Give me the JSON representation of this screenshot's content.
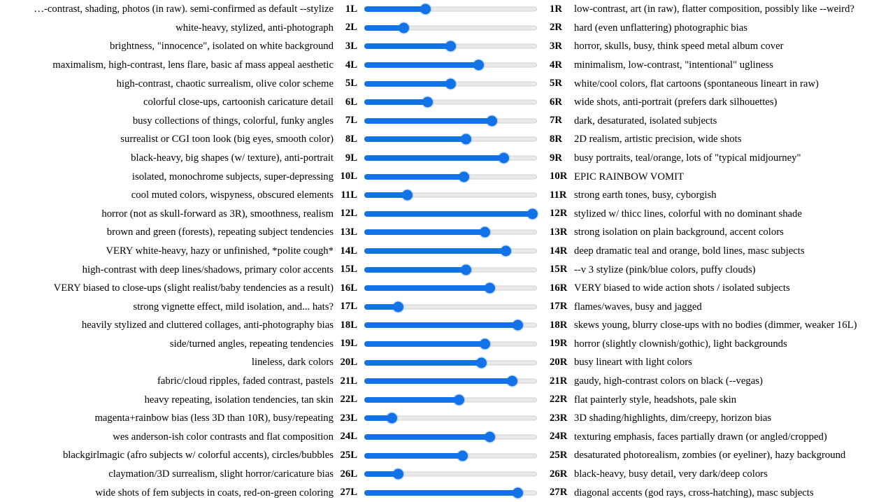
{
  "colors": {
    "slider_fill": "#1272e8",
    "slider_track": "#e9e9ea",
    "text": "#000000",
    "background": "#ffffff"
  },
  "chart_data": {
    "type": "bar",
    "title": "",
    "xlabel": "",
    "ylabel": "",
    "xlim": [
      0,
      100
    ],
    "categories": [
      "1",
      "2",
      "3",
      "4",
      "5",
      "6",
      "7",
      "8",
      "9",
      "10",
      "11",
      "12",
      "13",
      "14",
      "15",
      "16",
      "17",
      "18",
      "19",
      "20",
      "21",
      "22",
      "23",
      "24",
      "25",
      "26",
      "27"
    ],
    "values": [
      35.5,
      23,
      50,
      66.5,
      50,
      37,
      74,
      59,
      81,
      58,
      25,
      97.5,
      70,
      82,
      59,
      73,
      20,
      89,
      70,
      68,
      86,
      55,
      16,
      73,
      57,
      20,
      89
    ]
  },
  "rows": [
    {
      "num_left": "1L",
      "num_right": "1R",
      "left": "…-contrast, shading, photos (in raw). semi-confirmed as default --stylize",
      "right": "low-contrast, art (in raw), flatter composition, possibly like --weird?",
      "value": 35.5
    },
    {
      "num_left": "2L",
      "num_right": "2R",
      "left": "white-heavy, stylized, anti-photograph",
      "right": "hard (even unflattering) photographic bias",
      "value": 23
    },
    {
      "num_left": "3L",
      "num_right": "3R",
      "left": "brightness, \"innocence\", isolated on white background",
      "right": "horror, skulls, busy, think speed metal album cover",
      "value": 50
    },
    {
      "num_left": "4L",
      "num_right": "4R",
      "left": "maximalism, high-contrast, lens flare, basic af mass appeal aesthetic",
      "right": "minimalism, low-contrast, \"intentional\" ugliness",
      "value": 66.5
    },
    {
      "num_left": "5L",
      "num_right": "5R",
      "left": "high-contrast, chaotic surrealism, olive color scheme",
      "right": "white/cool colors, flat cartoons (spontaneous lineart in raw)",
      "value": 50
    },
    {
      "num_left": "6L",
      "num_right": "6R",
      "left": "colorful close-ups, cartoonish caricature detail",
      "right": "wide shots, anti-portrait (prefers dark silhouettes)",
      "value": 37
    },
    {
      "num_left": "7L",
      "num_right": "7R",
      "left": "busy collections of things, colorful, funky angles",
      "right": "dark, desaturated, isolated subjects",
      "value": 74
    },
    {
      "num_left": "8L",
      "num_right": "8R",
      "left": "surrealist or CGI toon look (big eyes, smooth color)",
      "right": "2D realism, artistic precision, wide shots",
      "value": 59
    },
    {
      "num_left": "9L",
      "num_right": "9R",
      "left": "black-heavy, big shapes (w/ texture), anti-portrait",
      "right": "busy portraits, teal/orange, lots of \"typical midjourney\"",
      "value": 81
    },
    {
      "num_left": "10L",
      "num_right": "10R",
      "left": "isolated, monochrome subjects, super-depressing",
      "right": "EPIC RAINBOW VOMIT",
      "value": 58
    },
    {
      "num_left": "11L",
      "num_right": "11R",
      "left": "cool muted colors, wispyness, obscured elements",
      "right": "strong earth tones, busy, cyborgish",
      "value": 25
    },
    {
      "num_left": "12L",
      "num_right": "12R",
      "left": "horror (not as skull-forward as 3R), smoothness, realism",
      "right": "stylized w/ thicc lines, colorful with no dominant shade",
      "value": 97.5
    },
    {
      "num_left": "13L",
      "num_right": "13R",
      "left": "brown and green (forests), repeating subject tendencies",
      "right": "strong isolation on plain background, accent colors",
      "value": 70
    },
    {
      "num_left": "14L",
      "num_right": "14R",
      "left": "VERY white-heavy, hazy or unfinished, *polite cough*",
      "right": "deep dramatic teal and orange, bold lines, masc subjects",
      "value": 82
    },
    {
      "num_left": "15L",
      "num_right": "15R",
      "left": "high-contrast with deep lines/shadows, primary color accents",
      "right": "--v 3 stylize (pink/blue colors, puffy clouds)",
      "value": 59
    },
    {
      "num_left": "16L",
      "num_right": "16R",
      "left": "VERY biased to close-ups (slight realist/baby tendencies as a result)",
      "right": "VERY biased to wide action shots / isolated subjects",
      "value": 73
    },
    {
      "num_left": "17L",
      "num_right": "17R",
      "left": "strong vignette effect, mild isolation, and... hats?",
      "right": "flames/waves, busy and jagged",
      "value": 20
    },
    {
      "num_left": "18L",
      "num_right": "18R",
      "left": "heavily stylized and cluttered collages, anti-photography bias",
      "right": "skews young, blurry close-ups with no bodies (dimmer, weaker 16L)",
      "value": 89
    },
    {
      "num_left": "19L",
      "num_right": "19R",
      "left": "side/turned angles, repeating tendencies",
      "right": "horror (slightly clownish/gothic), light backgrounds",
      "value": 70
    },
    {
      "num_left": "20L",
      "num_right": "20R",
      "left": "lineless, dark colors",
      "right": "busy lineart with light colors",
      "value": 68
    },
    {
      "num_left": "21L",
      "num_right": "21R",
      "left": "fabric/cloud ripples, faded contrast, pastels",
      "right": "gaudy, high-contrast colors on black (--vegas)",
      "value": 86
    },
    {
      "num_left": "22L",
      "num_right": "22R",
      "left": "heavy repeating, isolation tendencies, tan skin",
      "right": "flat painterly style, headshots, pale skin",
      "value": 55
    },
    {
      "num_left": "23L",
      "num_right": "23R",
      "left": "magenta+rainbow bias (less 3D than 10R), busy/repeating",
      "right": "3D shading/highlights, dim/creepy, horizon bias",
      "value": 16
    },
    {
      "num_left": "24L",
      "num_right": "24R",
      "left": "wes anderson-ish color contrasts and flat composition",
      "right": "texturing emphasis, faces partially drawn (or angled/cropped)",
      "value": 73
    },
    {
      "num_left": "25L",
      "num_right": "25R",
      "left": "blackgirlmagic (afro subjects w/ colorful accents), circles/bubbles",
      "right": "desaturated photorealism, zombies (or eyeliner), hazy background",
      "value": 57
    },
    {
      "num_left": "26L",
      "num_right": "26R",
      "left": "claymation/3D surrealism, slight horror/caricature bias",
      "right": "black-heavy, busy detail, very dark/deep colors",
      "value": 20
    },
    {
      "num_left": "27L",
      "num_right": "27R",
      "left": "wide shots of fem subjects in coats, red-on-green coloring",
      "right": "diagonal accents (god rays, cross-hatching), masc subjects",
      "value": 89
    }
  ]
}
